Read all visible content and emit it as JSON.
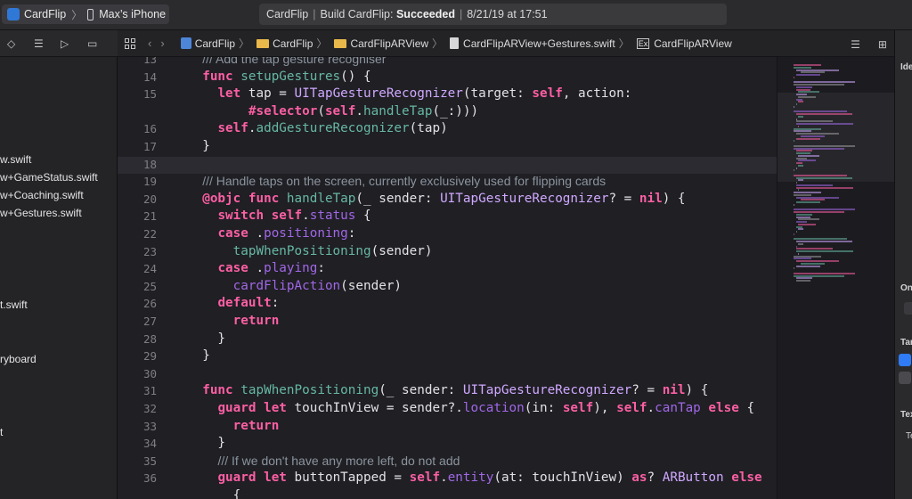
{
  "toolbar": {
    "scheme_target": "CardFlip",
    "scheme_device": "Max’s iPhone",
    "status_project": "CardFlip",
    "status_build_prefix": "Build CardFlip:",
    "status_result": "Succeeded",
    "status_date": "8/21/19 at 17:51"
  },
  "navigator": {
    "items": [
      {
        "label": "w.swift"
      },
      {
        "label": "w+GameStatus.swift"
      },
      {
        "label": "w+Coaching.swift"
      },
      {
        "label": "w+Gestures.swift"
      },
      {
        "label": "t.swift"
      },
      {
        "label": "ryboard"
      },
      {
        "label": "t"
      }
    ]
  },
  "jumpbar": {
    "crumbs": [
      "CardFlip",
      "CardFlip",
      "CardFlipARView",
      "CardFlipARView+Gestures.swift",
      "CardFlipARView"
    ],
    "ext_badge": "Ex"
  },
  "editor": {
    "current_line": "18",
    "lines": [
      {
        "n": "13",
        "t": "  /// Add the tap gesture recogniser"
      },
      {
        "n": "14",
        "t": "  func setupGestures() {"
      },
      {
        "n": "15",
        "t": "    let tap = UITapGestureRecognizer(target: self, action:"
      },
      {
        "n": "",
        "t": "        #selector(self.handleTap(_:)))"
      },
      {
        "n": "16",
        "t": "    self.addGestureRecognizer(tap)"
      },
      {
        "n": "17",
        "t": "  }"
      },
      {
        "n": "18",
        "t": ""
      },
      {
        "n": "19",
        "t": "  /// Handle taps on the screen, currently exclusively used for flipping cards"
      },
      {
        "n": "20",
        "t": "  @objc func handleTap(_ sender: UITapGestureRecognizer? = nil) {"
      },
      {
        "n": "21",
        "t": "    switch self.status {"
      },
      {
        "n": "22",
        "t": "    case .positioning:"
      },
      {
        "n": "23",
        "t": "      tapWhenPositioning(sender)"
      },
      {
        "n": "24",
        "t": "    case .playing:"
      },
      {
        "n": "25",
        "t": "      cardFlipAction(sender)"
      },
      {
        "n": "26",
        "t": "    default:"
      },
      {
        "n": "27",
        "t": "      return"
      },
      {
        "n": "28",
        "t": "    }"
      },
      {
        "n": "29",
        "t": "  }"
      },
      {
        "n": "30",
        "t": ""
      },
      {
        "n": "31",
        "t": "  func tapWhenPositioning(_ sender: UITapGestureRecognizer? = nil) {"
      },
      {
        "n": "32",
        "t": "    guard let touchInView = sender?.location(in: self), self.canTap else {"
      },
      {
        "n": "33",
        "t": "      return"
      },
      {
        "n": "34",
        "t": "    }"
      },
      {
        "n": "35",
        "t": "    /// If we don't have any more left, do not add"
      },
      {
        "n": "36",
        "t": "    guard let buttonTapped = self.entity(at: touchInView) as? ARButton else"
      },
      {
        "n": "",
        "t": "      {"
      }
    ]
  },
  "inspector": {
    "labels": [
      "Ide",
      "On",
      "Tar",
      "Tex",
      "Te"
    ]
  },
  "colors": {
    "keyword": "#fc5fa3",
    "function": "#67b7a4",
    "type": "#d0a8ff",
    "method": "#a167e6",
    "comment": "#8b949e",
    "editor_bg": "#1f1f24",
    "checkbox": "#2f7cf6"
  }
}
